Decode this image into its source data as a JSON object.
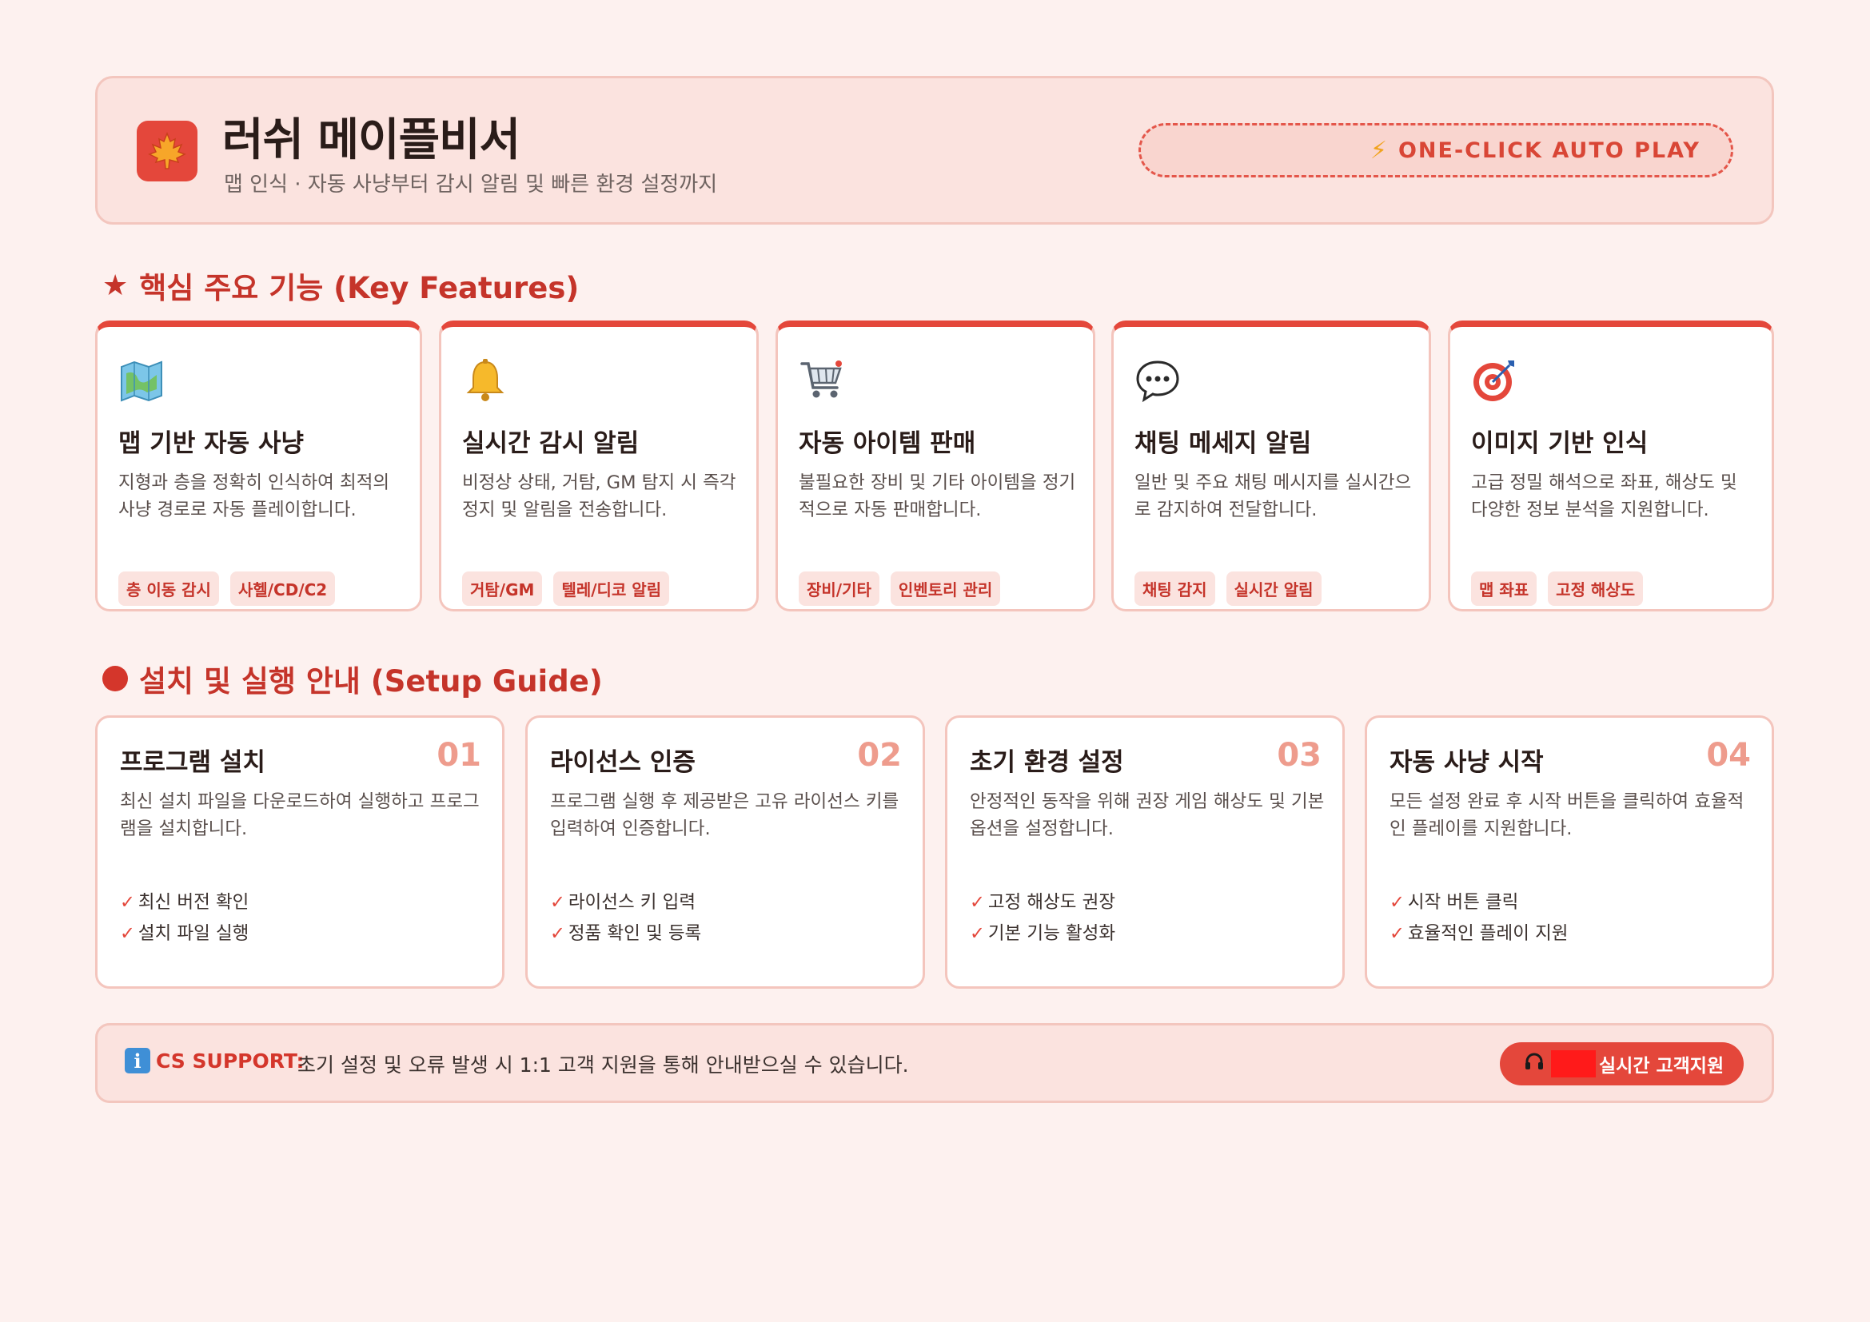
{
  "header": {
    "title": "러쉬 메이플비서",
    "subtitle": "맵 인식 · 자동 사냥부터 감시 알림 및 빠른 환경 설정까지",
    "autoplay_label": "ONE-CLICK AUTO PLAY",
    "logo_icon": "maple-leaf-icon",
    "autoplay_icon": "lightning-icon",
    "accent_color": "#e4473b"
  },
  "features": {
    "title": "핵심 주요 기능 (Key Features)",
    "cards": [
      {
        "icon": "map-icon",
        "title": "맵 기반 자동 사냥",
        "desc": "지형과 층을 정확히 인식하여 최적의 사냥 경로로 자동 플레이합니다.",
        "tags": [
          "층 이동 감시",
          "사헬/CD/C2"
        ]
      },
      {
        "icon": "bell-icon",
        "title": "실시간 감시 알림",
        "desc": "비정상 상태, 거탐, GM 탐지 시 즉각 정지 및 알림을 전송합니다.",
        "tags": [
          "거탐/GM",
          "텔레/디코 알림"
        ]
      },
      {
        "icon": "cart-icon",
        "title": "자동 아이템 판매",
        "desc": "불필요한 장비 및 기타 아이템을 정기적으로 자동 판매합니다.",
        "tags": [
          "장비/기타",
          "인벤토리 관리"
        ]
      },
      {
        "icon": "chat-bubble-icon",
        "title": "채팅 메세지 알림",
        "desc": "일반 및 주요 채팅 메시지를 실시간으로 감지하여 전달합니다.",
        "tags": [
          "채팅 감지",
          "실시간 알림"
        ]
      },
      {
        "icon": "target-icon",
        "title": "이미지 기반 인식",
        "desc": "고급 정밀 해석으로 좌표, 해상도 및 다양한 정보 분석을 지원합니다.",
        "tags": [
          "맵 좌표",
          "고정 해상도"
        ]
      }
    ]
  },
  "setup": {
    "title": "설치 및 실행 안내 (Setup Guide)",
    "steps": [
      {
        "title": "프로그램 설치",
        "num": "01",
        "desc": "최신 설치 파일을 다운로드하여 실행하고 프로그램을 설치합니다.",
        "checks": [
          "최신 버전 확인",
          "설치 파일 실행"
        ]
      },
      {
        "title": "라이선스 인증",
        "num": "02",
        "desc": "프로그램 실행 후 제공받은 고유 라이선스 키를 입력하여 인증합니다.",
        "checks": [
          "라이선스 키 입력",
          "정품 확인 및 등록"
        ]
      },
      {
        "title": "초기 환경 설정",
        "num": "03",
        "desc": "안정적인 동작을 위해 권장 게임 해상도 및 기본 옵션을 설정합니다.",
        "checks": [
          "고정 해상도 권장",
          "기본 기능 활성화"
        ]
      },
      {
        "title": "자동 사냥 시작",
        "num": "04",
        "desc": "모든 설정 완료 후 시작 버튼을 클릭하여 효율적인 플레이를 지원합니다.",
        "checks": [
          "시작 버튼 클릭",
          "효율적인 플레이 지원"
        ]
      }
    ]
  },
  "support": {
    "icon": "info-icon",
    "label": "CS SUPPORT:",
    "text": "초기 설정 및 오류 발생 시 1:1 고객 지원을 통해 안내받으실 수 있습니다.",
    "button_icon": "headphones-icon",
    "button_label": "실시간 고객지원"
  }
}
